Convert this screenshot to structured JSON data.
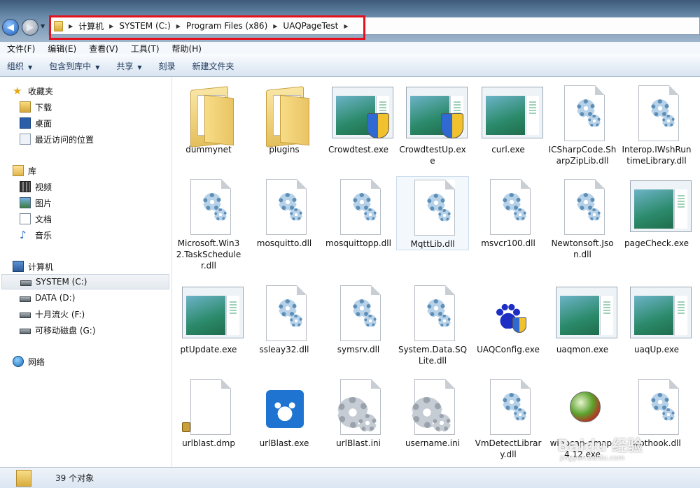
{
  "address": {
    "crumbs": [
      "计算机",
      "SYSTEM (C:)",
      "Program Files (x86)",
      "UAQPageTest"
    ]
  },
  "menu": [
    "文件(F)",
    "编辑(E)",
    "查看(V)",
    "工具(T)",
    "帮助(H)"
  ],
  "commands": {
    "organize": "组织",
    "include": "包含到库中",
    "share": "共享",
    "burn": "刻录",
    "new_folder": "新建文件夹"
  },
  "nav": {
    "favorites": "收藏夹",
    "downloads": "下载",
    "desktop": "桌面",
    "recent": "最近访问的位置",
    "libraries": "库",
    "videos": "视频",
    "pictures": "图片",
    "documents": "文档",
    "music": "音乐",
    "computer": "计算机",
    "drive_c": "SYSTEM (C:)",
    "drive_d": "DATA (D:)",
    "drive_f": "十月流火 (F:)",
    "drive_g": "可移动磁盘 (G:)",
    "network": "网络"
  },
  "files": [
    {
      "name": "dummynet",
      "type": "folder"
    },
    {
      "name": "plugins",
      "type": "folder"
    },
    {
      "name": "Crowdtest.exe",
      "type": "exe-shield"
    },
    {
      "name": "CrowdtestUp.exe",
      "type": "exe-shield"
    },
    {
      "name": "curl.exe",
      "type": "exe"
    },
    {
      "name": "ICSharpCode.SharpZipLib.dll",
      "type": "dll"
    },
    {
      "name": "Interop.IWshRuntimeLibrary.dll",
      "type": "dll"
    },
    {
      "name": "Microsoft.Win32.TaskScheduler.dll",
      "type": "dll"
    },
    {
      "name": "mosquitto.dll",
      "type": "dll"
    },
    {
      "name": "mosquittopp.dll",
      "type": "dll"
    },
    {
      "name": "MqttLib.dll",
      "type": "dll"
    },
    {
      "name": "msvcr100.dll",
      "type": "dll"
    },
    {
      "name": "Newtonsoft.Json.dll",
      "type": "dll"
    },
    {
      "name": "pageCheck.exe",
      "type": "exe"
    },
    {
      "name": "ptUpdate.exe",
      "type": "exe"
    },
    {
      "name": "ssleay32.dll",
      "type": "dll"
    },
    {
      "name": "symsrv.dll",
      "type": "dll"
    },
    {
      "name": "System.Data.SQLite.dll",
      "type": "dll"
    },
    {
      "name": "UAQConfig.exe",
      "type": "paw"
    },
    {
      "name": "uaqmon.exe",
      "type": "exe"
    },
    {
      "name": "uaqUp.exe",
      "type": "exe"
    },
    {
      "name": "urlblast.dmp",
      "type": "dmp"
    },
    {
      "name": "urlBlast.exe",
      "type": "blast"
    },
    {
      "name": "urlBlast.ini",
      "type": "ini"
    },
    {
      "name": "username.ini",
      "type": "ini"
    },
    {
      "name": "VmDetectLibrary.dll",
      "type": "dll"
    },
    {
      "name": "winpcap-nmap-4.12.exe",
      "type": "ball"
    },
    {
      "name": "wpthook.dll",
      "type": "dll"
    }
  ],
  "status": {
    "count": "39 个对象"
  },
  "watermark": {
    "text": "Baidu 经验",
    "sub": "jingyan.baidu.com"
  },
  "colors": {
    "highlight": "#e5121e",
    "nav_selected": "#e4e9ef"
  }
}
